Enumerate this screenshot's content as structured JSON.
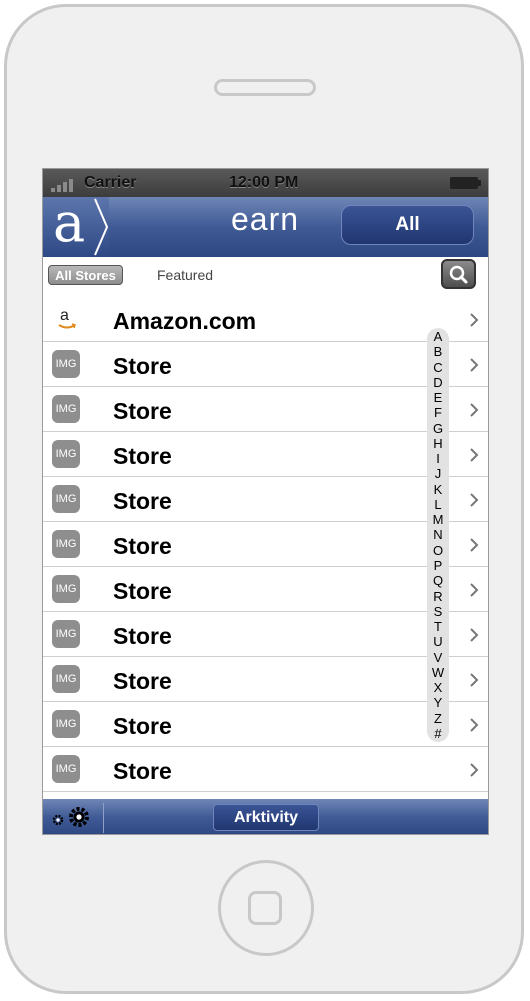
{
  "status_bar": {
    "carrier": "Carrier",
    "time": "12:00 PM"
  },
  "nav": {
    "logo_letter": "a",
    "title": "earn",
    "right_button": "All"
  },
  "segments": {
    "all_stores": "All Stores",
    "featured": "Featured"
  },
  "stores": [
    {
      "name": "Amazon.com",
      "icon": "amazon-logo-icon",
      "icon_text": "a"
    },
    {
      "name": "Store",
      "icon": "img-placeholder-icon",
      "icon_text": "IMG"
    },
    {
      "name": "Store",
      "icon": "img-placeholder-icon",
      "icon_text": "IMG"
    },
    {
      "name": "Store",
      "icon": "img-placeholder-icon",
      "icon_text": "IMG"
    },
    {
      "name": "Store",
      "icon": "img-placeholder-icon",
      "icon_text": "IMG"
    },
    {
      "name": "Store",
      "icon": "img-placeholder-icon",
      "icon_text": "IMG"
    },
    {
      "name": "Store",
      "icon": "img-placeholder-icon",
      "icon_text": "IMG"
    },
    {
      "name": "Store",
      "icon": "img-placeholder-icon",
      "icon_text": "IMG"
    },
    {
      "name": "Store",
      "icon": "img-placeholder-icon",
      "icon_text": "IMG"
    },
    {
      "name": "Store",
      "icon": "img-placeholder-icon",
      "icon_text": "IMG"
    },
    {
      "name": "Store",
      "icon": "img-placeholder-icon",
      "icon_text": "IMG"
    }
  ],
  "alpha_index": [
    "A",
    "B",
    "C",
    "D",
    "E",
    "F",
    "G",
    "H",
    "I",
    "J",
    "K",
    "L",
    "M",
    "N",
    "O",
    "P",
    "Q",
    "R",
    "S",
    "T",
    "U",
    "V",
    "W",
    "X",
    "Y",
    "Z",
    "#"
  ],
  "toolbar": {
    "activity_button": "Arktivity"
  },
  "colors": {
    "nav_blue": "#3f5a95",
    "button_blue": "#1f3670",
    "icon_gray": "#8e8e8e"
  }
}
